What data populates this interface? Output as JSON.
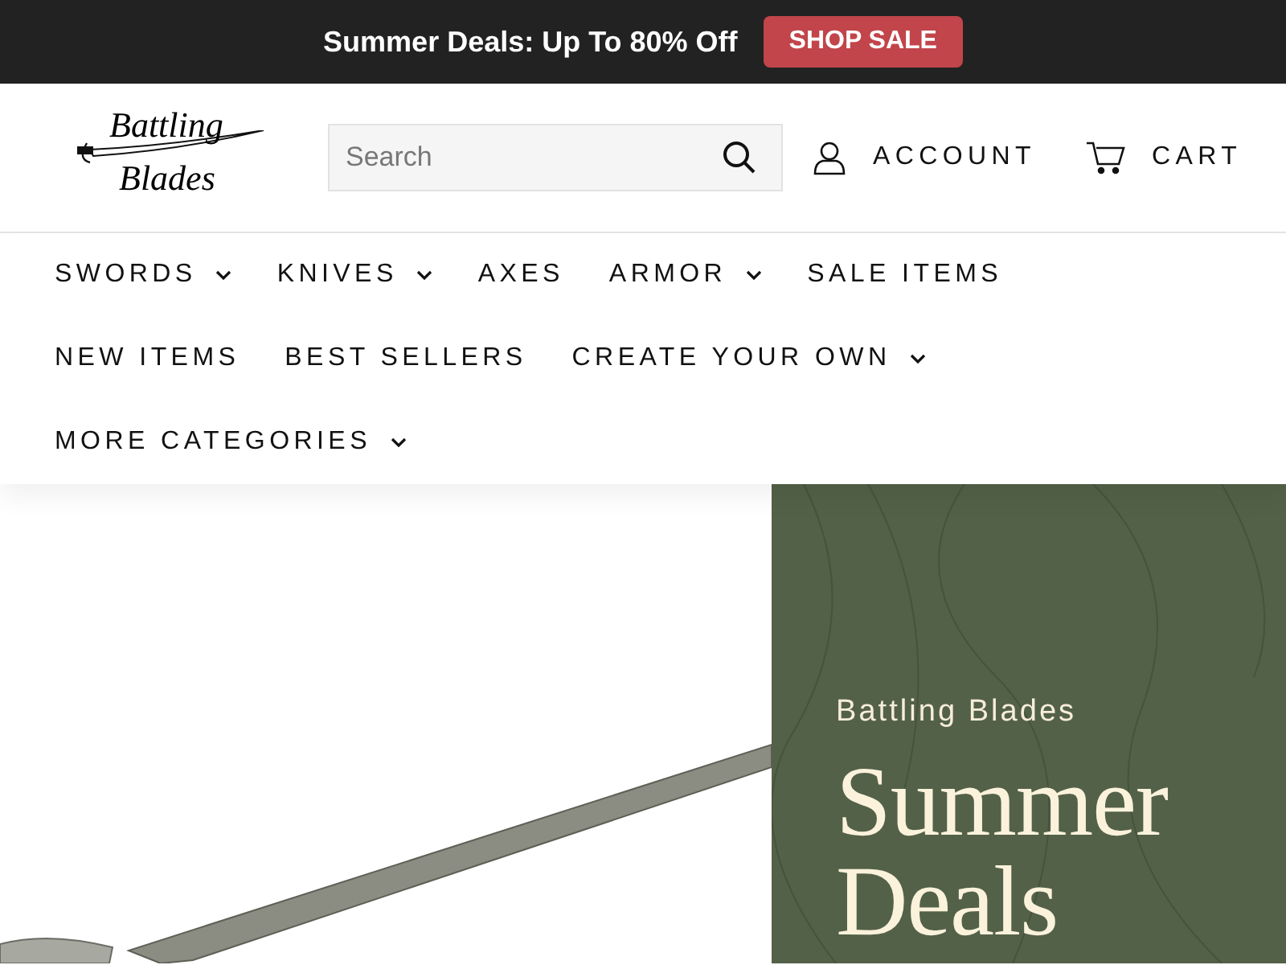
{
  "announcement": {
    "text": "Summer Deals: Up To 80% Off",
    "button": "SHOP SALE"
  },
  "logo": {
    "lines": [
      "Battling",
      "Blades"
    ]
  },
  "search": {
    "placeholder": "Search"
  },
  "header_links": [
    {
      "kind": "account",
      "label": "ACCOUNT"
    },
    {
      "kind": "cart",
      "label": "CART"
    }
  ],
  "nav": [
    {
      "label": "SWORDS",
      "dropdown": true
    },
    {
      "label": "KNIVES",
      "dropdown": true
    },
    {
      "label": "AXES",
      "dropdown": false
    },
    {
      "label": "ARMOR",
      "dropdown": true
    },
    {
      "label": "SALE ITEMS",
      "dropdown": false
    },
    {
      "label": "NEW ITEMS",
      "dropdown": false
    },
    {
      "label": "BEST SELLERS",
      "dropdown": false
    },
    {
      "label": "CREATE YOUR OWN",
      "dropdown": true
    },
    {
      "label": "MORE CATEGORIES",
      "dropdown": true
    }
  ],
  "hero": {
    "eyebrow": "Battling Blades",
    "heading_lines": [
      "Summer",
      "Deals"
    ]
  }
}
